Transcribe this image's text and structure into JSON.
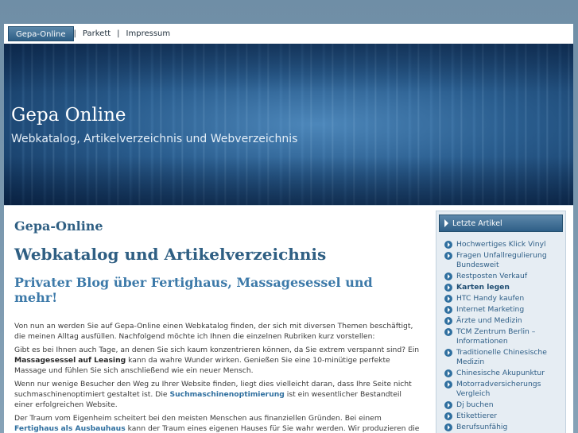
{
  "nav": {
    "items": [
      "Gepa-Online",
      "Parkett",
      "Impressum"
    ],
    "separator": "|"
  },
  "header": {
    "title": "Gepa Online",
    "tagline": "Webkatalog, Artikelverzeichnis und Webverzeichnis"
  },
  "main": {
    "heading_small": "Gepa-Online",
    "heading_big": "Webkatalog und Artikelverzeichnis",
    "heading_mid": "Privater Blog über Fertighaus, Massagesessel und mehr!",
    "p1": "Von nun an werden Sie auf Gepa-Online einen Webkatalog finden, der sich mit diversen Themen beschäftigt, die meinen Alltag ausfüllen. Nachfolgend möchte ich Ihnen die einzelnen Rubriken kurz vorstellen:",
    "p2": {
      "a": "Gibt es bei Ihnen auch Tage, an denen Sie sich kaum konzentrieren können, da Sie extrem verspannt sind? Ein ",
      "bold1": "Massagesessel",
      "b": " ",
      "bold2": "auf Leasing",
      "c": " kann da wahre Wunder wirken. Genießen Sie eine 10-minütige perfekte Massage und fühlen Sie sich anschließend wie ein neuer Mensch."
    },
    "p3": {
      "a": "Wenn nur wenige Besucher den Weg zu Ihrer Website finden, liegt dies vielleicht daran, dass Ihre Seite nicht suchmaschinenoptimiert gestaltet ist. Die ",
      "link": "Suchmaschinenoptimierung",
      "b": " ist ein wesentlicher Bestandteil einer erfolgreichen Website."
    },
    "p4": {
      "a": "Der Traum vom Eigenheim scheitert bei den meisten Menschen aus finanziellen Gründen. Bei einem ",
      "link1": "Fertighaus",
      "b": " ",
      "link2": "als Ausbauhaus",
      "c": " kann der Traum eines eigenen Hauses für Sie wahr werden. Wir produzieren die gesamten"
    }
  },
  "sidebar": {
    "title": "Letzte Artikel",
    "items": [
      "Hochwertiges Klick Vinyl",
      "Fragen Unfallregulierung Bundesweit",
      "Restposten Verkauf",
      "Karten legen",
      "HTC Handy kaufen",
      "Internet Marketing",
      "Ärzte und Medizin",
      "TCM Zentrum Berlin – Informationen",
      "Traditionelle Chinesische Medizin",
      "Chinesische Akupunktur",
      "Motorradversicherungs Vergleich",
      "Dj buchen",
      "Etikettierer",
      "Berufsunfähig"
    ]
  },
  "colors": {
    "accent": "#2f5f87",
    "link": "#2f6f9f",
    "banner_dark": "#0e2f56",
    "page_bg": "#7b98ae"
  }
}
